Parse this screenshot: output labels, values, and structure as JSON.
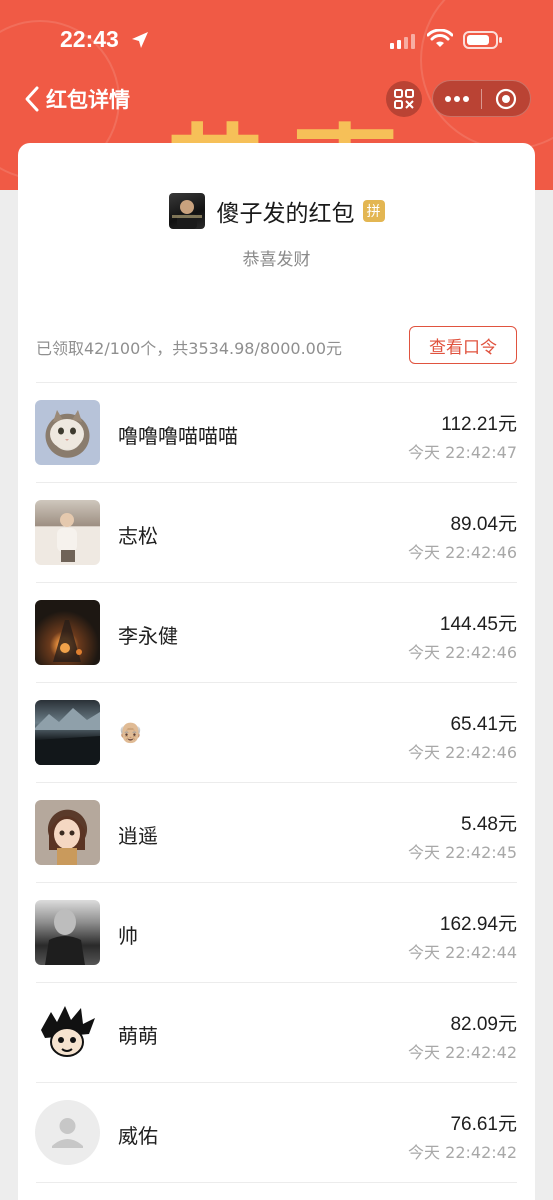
{
  "status_bar": {
    "time": "22:43"
  },
  "nav": {
    "back_title": "红包详情"
  },
  "header": {
    "decor_text": [
      "恭",
      "喜"
    ]
  },
  "sender": {
    "name": "傻子发的红包",
    "badge": "拼",
    "wish": "恭喜发财"
  },
  "summary": {
    "text": "已领取42/100个，共3534.98/8000.00元",
    "view_command_label": "查看口令"
  },
  "recipients": [
    {
      "name": "噜噜噜喵喵喵",
      "amount": "112.21元",
      "time": "今天  22:42:47"
    },
    {
      "name": "志松",
      "amount": "89.04元",
      "time": "今天  22:42:46"
    },
    {
      "name": "李永健",
      "amount": "144.45元",
      "time": "今天  22:42:46"
    },
    {
      "name": "👴🏼",
      "amount": "65.41元",
      "time": "今天  22:42:46"
    },
    {
      "name": "逍遥",
      "amount": "5.48元",
      "time": "今天  22:42:45"
    },
    {
      "name": "帅",
      "amount": "162.94元",
      "time": "今天  22:42:44"
    },
    {
      "name": "萌萌",
      "amount": "82.09元",
      "time": "今天  22:42:42"
    },
    {
      "name": "威佑",
      "amount": "76.61元",
      "time": "今天  22:42:42"
    }
  ],
  "colors": {
    "header_red": "#f05a45",
    "accent_red": "#e0533f",
    "gold": "#f7c65a",
    "badge_gold": "#e3b652"
  }
}
